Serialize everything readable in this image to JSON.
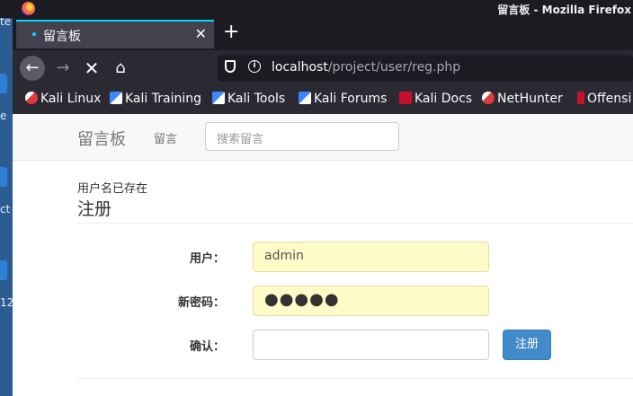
{
  "window": {
    "title": "留言板 - Mozilla Firefox"
  },
  "desktop": {
    "labels": [
      "te",
      "e",
      "ct",
      "12"
    ]
  },
  "tabs": [
    {
      "title": "留言板"
    }
  ],
  "nav": {
    "url_host": "localhost",
    "url_path": "/project/user/reg.php"
  },
  "bookmarks": [
    {
      "label": "Kali Linux",
      "icon": "kali-dragon-icon"
    },
    {
      "label": "Kali Training",
      "icon": "kali-tools-icon"
    },
    {
      "label": "Kali Tools",
      "icon": "kali-tools-icon"
    },
    {
      "label": "Kali Forums",
      "icon": "kali-tools-icon"
    },
    {
      "label": "Kali Docs",
      "icon": "kali-docs-icon"
    },
    {
      "label": "NetHunter",
      "icon": "kali-dragon-icon"
    },
    {
      "label": "Offensi",
      "icon": "offsec-icon"
    }
  ],
  "site": {
    "brand": "留言板",
    "nav_link": "留言",
    "search_placeholder": "搜索留言"
  },
  "form": {
    "message": "用户名已存在",
    "heading": "注册",
    "user_label": "用户：",
    "user_value": "admin",
    "password_label": "新密码：",
    "password_value": "●●●●●",
    "confirm_label": "确认：",
    "confirm_value": "",
    "submit_label": "注册"
  },
  "colors": {
    "accent": "#428bca",
    "autofill": "#fffbc8",
    "tab_highlight": "#00ddff"
  }
}
